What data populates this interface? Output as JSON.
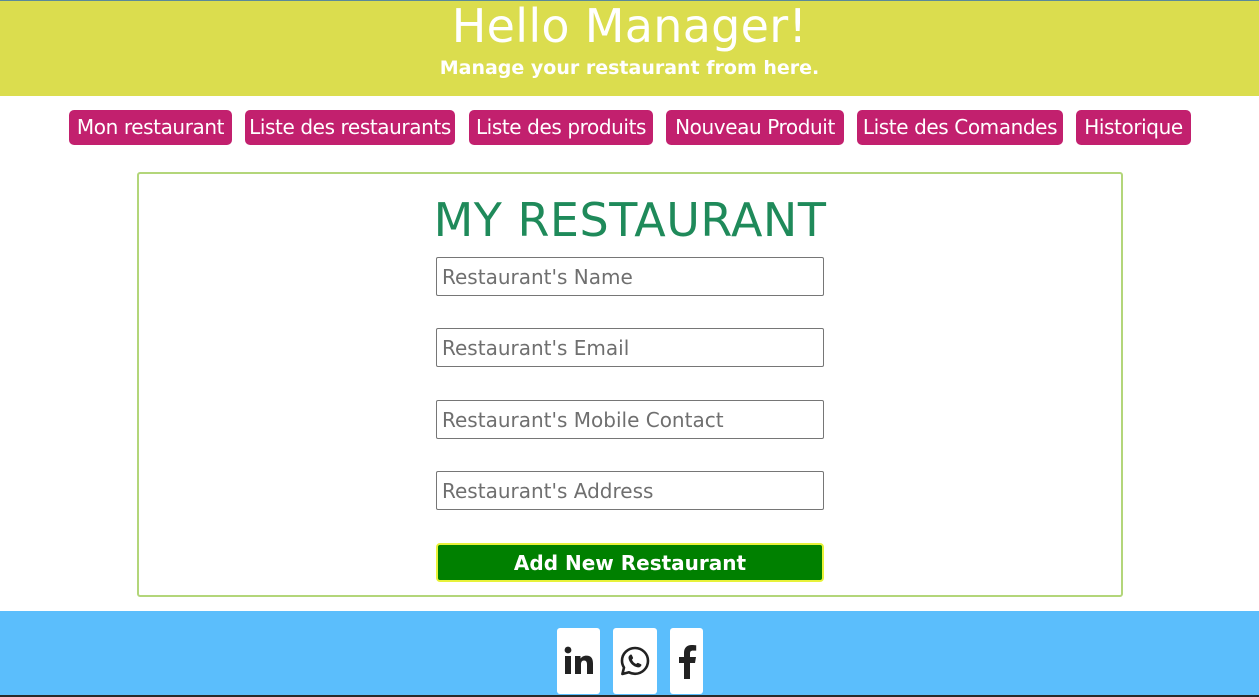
{
  "header": {
    "title": "Hello Manager!",
    "subtitle": "Manage your restaurant from here."
  },
  "nav": {
    "items": [
      {
        "label": "Mon restaurant"
      },
      {
        "label": "Liste des restaurants"
      },
      {
        "label": "Liste des produits"
      },
      {
        "label": "Nouveau Produit"
      },
      {
        "label": "Liste des Comandes"
      },
      {
        "label": "Historique"
      }
    ]
  },
  "form": {
    "title": "MY RESTAURANT",
    "fields": [
      {
        "placeholder": "Restaurant's Name",
        "value": ""
      },
      {
        "placeholder": "Restaurant's Email",
        "value": ""
      },
      {
        "placeholder": "Restaurant's Mobile Contact",
        "value": ""
      },
      {
        "placeholder": "Restaurant's Address",
        "value": ""
      }
    ],
    "submit_label": "Add New Restaurant"
  },
  "footer": {
    "social": [
      {
        "icon": "linkedin-icon"
      },
      {
        "icon": "whatsapp-icon"
      },
      {
        "icon": "facebook-icon"
      }
    ]
  },
  "colors": {
    "header_bg": "#dbdd4e",
    "nav_bg": "#c2206e",
    "title_green": "#1f8a5a",
    "button_green": "#008000",
    "footer_bg": "#5bbefc",
    "card_border": "#b3d67a"
  }
}
